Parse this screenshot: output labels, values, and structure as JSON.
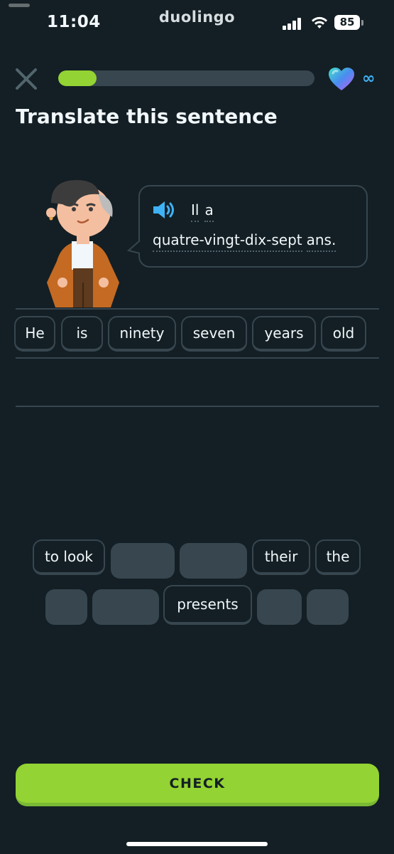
{
  "status_bar": {
    "time": "11:04",
    "app_name": "duolingo",
    "battery": "85"
  },
  "header": {
    "progress_percent": 15,
    "hearts_icon": "heart-icon",
    "hearts_value": "∞"
  },
  "lesson": {
    "title": "Translate this sentence",
    "prompt_words_line1": [
      "Il",
      "a"
    ],
    "prompt_words_line2": [
      "quatre-vingt-dix-sept",
      "ans."
    ]
  },
  "answer_words": [
    "He",
    "is",
    "ninety",
    "seven",
    "years",
    "old"
  ],
  "word_bank": {
    "row1": [
      "to look",
      "",
      "",
      "their",
      "the"
    ],
    "row2": [
      "",
      "",
      "presents",
      "",
      ""
    ]
  },
  "footer": {
    "check_label": "CHECK"
  },
  "colors": {
    "background": "#131f24",
    "accent_green": "#93d333",
    "chip_border": "#37464f",
    "infinity_blue": "#3fb1f5"
  }
}
